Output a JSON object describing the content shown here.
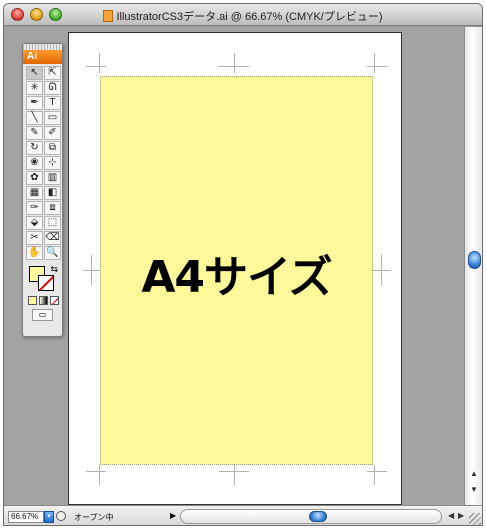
{
  "window": {
    "title": "IllustratorCS3データ.ai @ 66.67% (CMYK/プレビュー)"
  },
  "toolbox": {
    "logo": "Ai",
    "tools": [
      {
        "name": "selection-tool",
        "glyph": "↖",
        "active": true
      },
      {
        "name": "direct-selection-tool",
        "glyph": "⇱"
      },
      {
        "name": "magic-wand-tool",
        "glyph": "✳"
      },
      {
        "name": "lasso-tool",
        "glyph": "ᘏ"
      },
      {
        "name": "pen-tool",
        "glyph": "✒"
      },
      {
        "name": "type-tool",
        "glyph": "T"
      },
      {
        "name": "line-tool",
        "glyph": "╲"
      },
      {
        "name": "rectangle-tool",
        "glyph": "▭"
      },
      {
        "name": "paintbrush-tool",
        "glyph": "✎"
      },
      {
        "name": "pencil-tool",
        "glyph": "✐"
      },
      {
        "name": "rotate-tool",
        "glyph": "↻"
      },
      {
        "name": "scale-tool",
        "glyph": "⧉"
      },
      {
        "name": "warp-tool",
        "glyph": "❀"
      },
      {
        "name": "free-transform-tool",
        "glyph": "⊹"
      },
      {
        "name": "symbol-sprayer-tool",
        "glyph": "✿"
      },
      {
        "name": "column-graph-tool",
        "glyph": "▥"
      },
      {
        "name": "mesh-tool",
        "glyph": "▦"
      },
      {
        "name": "gradient-tool",
        "glyph": "◧"
      },
      {
        "name": "eyedropper-tool",
        "glyph": "✑"
      },
      {
        "name": "blend-tool",
        "glyph": "⧈"
      },
      {
        "name": "live-paint-bucket-tool",
        "glyph": "⬙"
      },
      {
        "name": "live-paint-selection-tool",
        "glyph": "⬚"
      },
      {
        "name": "slice-tool",
        "glyph": "✂"
      },
      {
        "name": "eraser-tool",
        "glyph": "⌫"
      },
      {
        "name": "hand-tool",
        "glyph": "✋"
      },
      {
        "name": "zoom-tool",
        "glyph": "🔍"
      }
    ],
    "swap_glyph": "⇆",
    "screen_mode_glyph": "▭"
  },
  "document": {
    "page_label": "A4サイズ",
    "page_color": "#fdf89a"
  },
  "status": {
    "zoom": "66.67%",
    "status_text": "オープン中",
    "play_glyph": "▶",
    "prev_glyph": "◀",
    "next_glyph": "▶"
  },
  "scroll": {
    "up_glyph": "▲",
    "down_glyph": "▼"
  }
}
